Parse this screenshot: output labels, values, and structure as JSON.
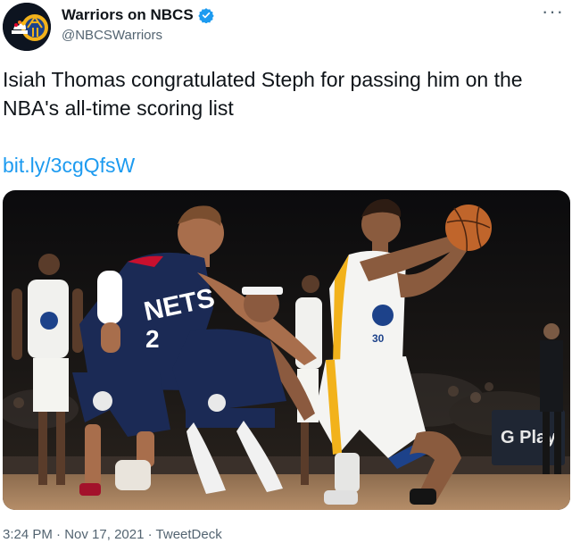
{
  "header": {
    "display_name": "Warriors on NBCS",
    "handle": "@NBCSWarriors",
    "more_label": "···"
  },
  "tweet": {
    "text": "Isiah Thomas congratulated Steph for passing him on the NBA's all-time scoring list",
    "link": "bit.ly/3cgQfsW"
  },
  "media": {
    "jersey_left": "NETS",
    "jersey_left_number": "2",
    "jersey_right_number": "30",
    "sign_text": "G Play"
  },
  "footer": {
    "time": "3:24 PM",
    "date": "Nov 17, 2021",
    "source": "TweetDeck",
    "separator": "·"
  },
  "colors": {
    "link": "#1d9bf0",
    "verified": "#1d9bf0",
    "muted": "#536471",
    "nets_navy": "#1b2a55",
    "warriors_gold": "#f2b21b"
  },
  "icons": [
    "verified-badge-icon",
    "more-options-icon"
  ]
}
